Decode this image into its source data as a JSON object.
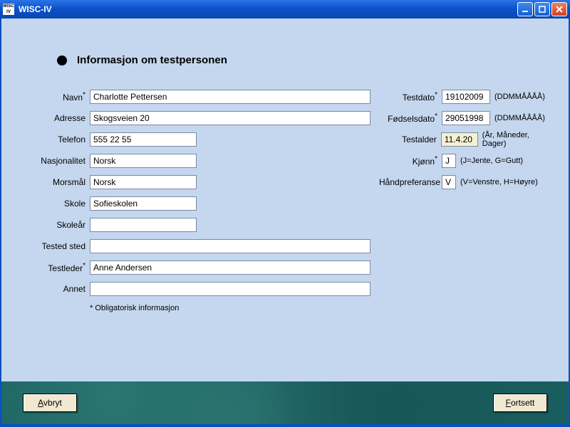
{
  "window": {
    "title": "WISC-IV",
    "icon_top": "WISC",
    "icon_bot": "IV"
  },
  "header": {
    "title": "Informasjon om testpersonen"
  },
  "labels": {
    "navn": "Navn",
    "adresse": "Adresse",
    "telefon": "Telefon",
    "nasjonalitet": "Nasjonalitet",
    "morsmal": "Morsmål",
    "skole": "Skole",
    "skolear": "Skoleår",
    "tested_sted": "Tested sted",
    "testleder": "Testleder",
    "annet": "Annet",
    "testdato": "Testdato",
    "fodselsdato": "Fødselsdato",
    "testalder": "Testalder",
    "kjonn": "Kjønn",
    "handpreferanse": "Håndpreferanse"
  },
  "values": {
    "navn": "Charlotte Pettersen",
    "adresse": "Skogsveien 20",
    "telefon": "555 22 55",
    "nasjonalitet": "Norsk",
    "morsmal": "Norsk",
    "skole": "Sofieskolen",
    "skolear": "",
    "tested_sted": "",
    "testleder": "Anne Andersen",
    "annet": "",
    "testdato": "19102009",
    "fodselsdato": "29051998",
    "testalder": "11.4.20",
    "kjonn": "J",
    "handpreferanse": "V"
  },
  "hints": {
    "ddmmaaaa": "(DDMMÅÅÅÅ)",
    "testalder": "(År, Måneder, Dager)",
    "kjonn": "(J=Jente, G=Gutt)",
    "handpreferanse": "(V=Venstre, H=Høyre)"
  },
  "star": "*",
  "obligatory_note": "* Obligatorisk informasjon",
  "buttons": {
    "cancel_first": "A",
    "cancel_rest": "vbryt",
    "continue_first": "F",
    "continue_rest": "ortsett"
  }
}
